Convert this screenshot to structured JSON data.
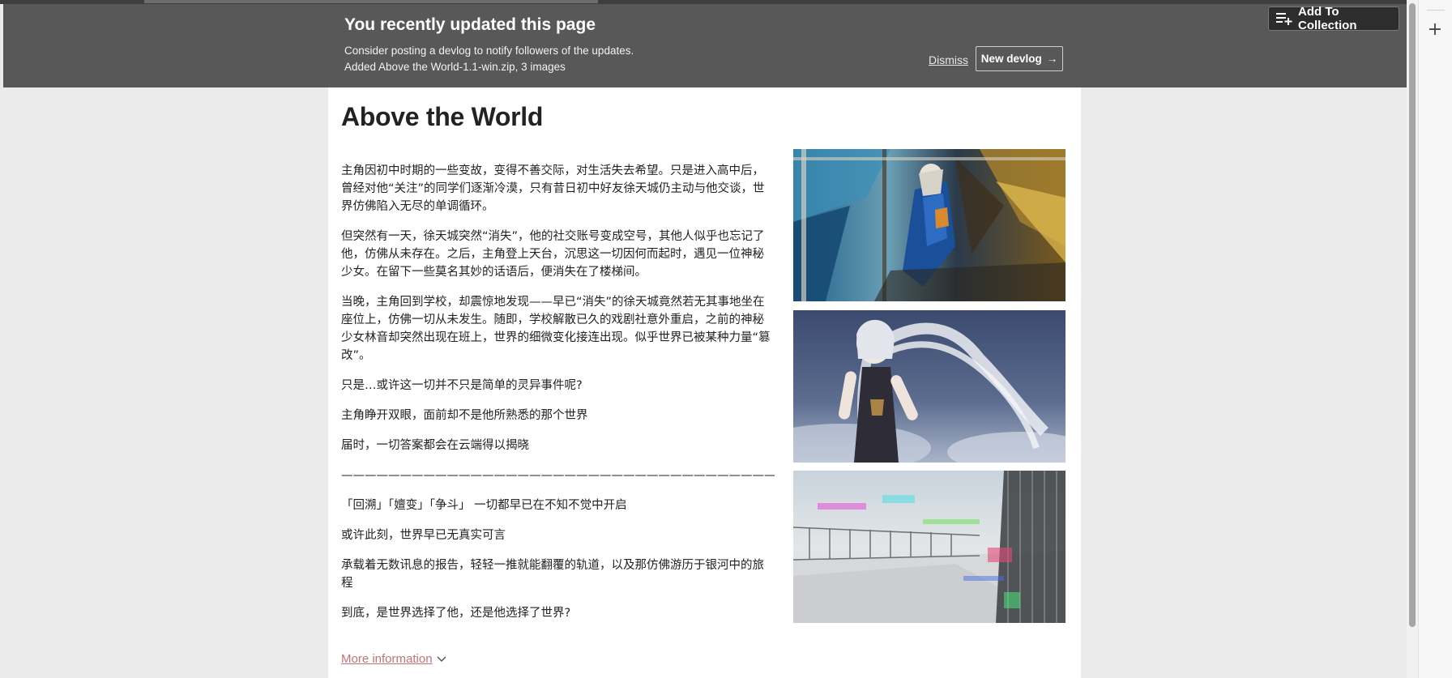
{
  "banner": {
    "title": "You recently updated this page",
    "line1": "Consider posting a devlog to notify followers of the updates.",
    "line2": "Added Above the World-1.1-win.zip, 3 images",
    "dismiss_label": "Dismiss",
    "new_devlog_label": "New devlog",
    "new_devlog_arrow": "→",
    "add_to_collection_label": "Add To Collection"
  },
  "side_panel": {
    "plus_glyph": "+"
  },
  "game": {
    "title": "Above the World",
    "description": [
      "主角因初中时期的一些变故，变得不善交际，对生活失去希望。只是进入高中后，曾经对他“关注”的同学们逐渐冷漠，只有昔日初中好友徐天城仍主动与他交谈，世界仿佛陷入无尽的单调循环。",
      "但突然有一天，徐天城突然“消失”，他的社交账号变成空号，其他人似乎也忘记了他，仿佛从未存在。之后，主角登上天台，沉思这一切因何而起时，遇见一位神秘少女。在留下一些莫名其妙的话语后，便消失在了楼梯间。",
      "当晚，主角回到学校，却震惊地发现——早已“消失”的徐天城竟然若无其事地坐在座位上，仿佛一切从未发生。随即，学校解散已久的戏剧社意外重启，之前的神秘少女林音却突然出现在班上，世界的细微变化接连出现。似乎世界已被某种力量“篡改”。",
      "只是…或许这一切并不只是简单的灵异事件呢?",
      "主角睁开双眼，面前却不是他所熟悉的那个世界",
      "届时，一切答案都会在云端得以揭晓",
      "————————————————————————————————————————",
      "「回溯」「嬗变」「争斗」 一切都早已在不知不觉中开启",
      "或许此刻，世界早已无真实可言",
      "承载着无数讯息的报告，轻轻一推就能翻覆的轨道，以及那仿佛游历于银河中的旅程",
      "到底，是世界选择了他，还是他选择了世界?"
    ],
    "more_information_label": "More information"
  },
  "screenshots": [
    {
      "icon": "screenshot-painted-figure-image"
    },
    {
      "icon": "screenshot-white-haired-girl-image"
    },
    {
      "icon": "screenshot-glitched-rooftop-image"
    }
  ],
  "colors": {
    "banner_bg": "#585858",
    "page_bg": "#ebebeb",
    "link_accent": "#c0737a"
  }
}
